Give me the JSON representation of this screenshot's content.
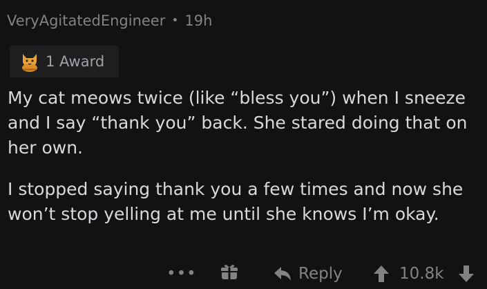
{
  "comment": {
    "username": "VeryAgitatedEngineer",
    "separator": "•",
    "time_ago": "19h",
    "award_label": "1 Award",
    "award_icon": "cat-award-icon",
    "paragraphs": [
      "My cat meows twice (like “bless you”) when I sneeze and I say “thank you” back. She stared doing that on her own.",
      "I stopped saying thank you a few times and now she won’t stop yelling at me until she knows I’m okay."
    ]
  },
  "actions": {
    "more_label": "•••",
    "gift_icon": "gift-icon",
    "reply_label": "Reply",
    "score": "10.8k",
    "upvote_icon": "upvote-arrow-icon",
    "downvote_icon": "downvote-arrow-icon"
  },
  "colors": {
    "background": "#121214",
    "text": "#d7dadc",
    "muted": "#818384",
    "award_bg": "#1e1e20",
    "award_icon": "#e8a33c"
  }
}
